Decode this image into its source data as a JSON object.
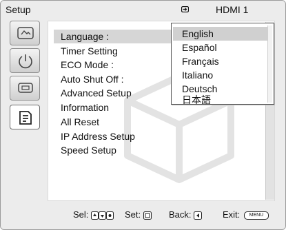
{
  "header": {
    "title": "Setup",
    "input_label": "HDMI 1"
  },
  "sidebar": {
    "items": [
      {
        "icon": "picture-icon"
      },
      {
        "icon": "power-icon"
      },
      {
        "icon": "screen-icon"
      },
      {
        "icon": "setup-icon",
        "active": true
      }
    ]
  },
  "menu": {
    "items": [
      "Language :",
      "Timer Setting",
      "ECO Mode :",
      "Auto Shut Off :",
      "Advanced Setup",
      "Information",
      "All Reset",
      "IP Address Setup",
      "Speed Setup"
    ],
    "selected_index": 0
  },
  "language_dropdown": {
    "options": [
      "English",
      "Español",
      "Français",
      "Italiano",
      "Deutsch",
      "日本語"
    ],
    "selected_index": 0
  },
  "footer": {
    "sel_label": "Sel:",
    "set_label": "Set:",
    "back_label": "Back:",
    "exit_label": "Exit:",
    "exit_key": "MENU"
  },
  "colors": {
    "background": "#ececec",
    "panel": "#ffffff",
    "highlight": "#d6d6d6",
    "text": "#111111"
  }
}
